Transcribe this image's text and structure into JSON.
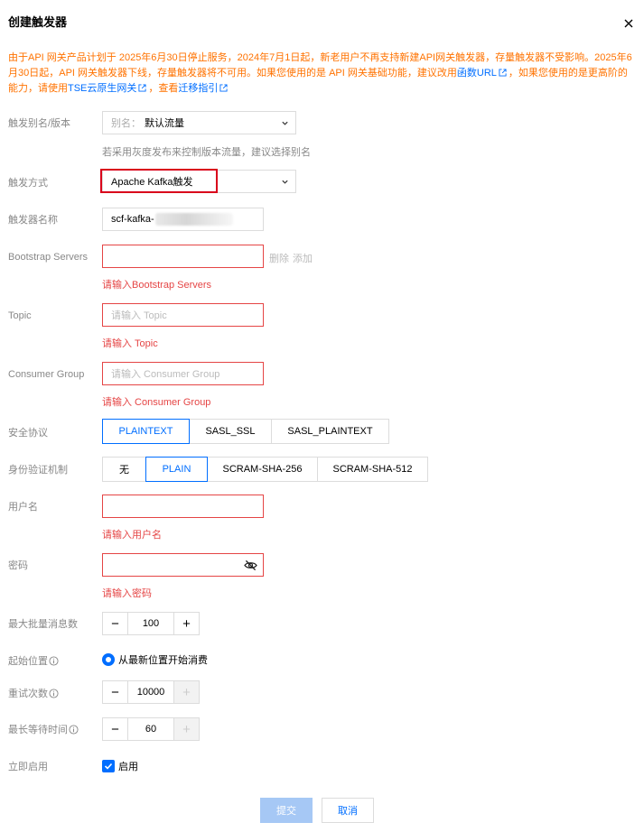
{
  "dialog": {
    "title": "创建触发器",
    "notice_part1": "由于API 网关产品计划于 2025年6月30日停止服务，2024年7月1日起，新老用户不再支持新建API网关触发器，存量触发器不受影响。2025年6月30日起，API 网关触发器下线，存量触发器将不可用。如果您使用的是 API 网关基础功能，建议改用",
    "notice_link1": "函数URL",
    "notice_part2": "，如果您使用的是更高阶的能力，请使用",
    "notice_link2": "TSE云原生网关",
    "notice_part3": "，查看",
    "notice_link3": "迁移指引"
  },
  "form": {
    "alias": {
      "label": "触发别名/版本",
      "prefix": "别名：",
      "value": "默认流量",
      "hint": "若采用灰度发布来控制版本流量，建议选择别名"
    },
    "trigger_type": {
      "label": "触发方式",
      "value": "Apache Kafka触发"
    },
    "trigger_name": {
      "label": "触发器名称",
      "value": "scf-kafka-"
    },
    "bootstrap": {
      "label": "Bootstrap Servers",
      "delete_label": "删除",
      "add_label": "添加",
      "error": "请输入Bootstrap Servers"
    },
    "topic": {
      "label": "Topic",
      "placeholder": "请输入 Topic",
      "error": "请输入 Topic"
    },
    "consumer_group": {
      "label": "Consumer Group",
      "placeholder": "请输入 Consumer Group",
      "error": "请输入 Consumer Group"
    },
    "security_protocol": {
      "label": "安全协议",
      "options": [
        "PLAINTEXT",
        "SASL_SSL",
        "SASL_PLAINTEXT"
      ],
      "selected": "PLAINTEXT"
    },
    "auth_mechanism": {
      "label": "身份验证机制",
      "options": [
        "无",
        "PLAIN",
        "SCRAM-SHA-256",
        "SCRAM-SHA-512"
      ],
      "selected": "PLAIN"
    },
    "username": {
      "label": "用户名",
      "error": "请输入用户名"
    },
    "password": {
      "label": "密码",
      "error": "请输入密码"
    },
    "max_batch": {
      "label": "最大批量消息数",
      "value": "100"
    },
    "start_position": {
      "label": "起始位置",
      "option": "从最新位置开始消费"
    },
    "retry_count": {
      "label": "重试次数",
      "value": "10000"
    },
    "max_wait": {
      "label": "最长等待时间",
      "value": "60"
    },
    "enable_now": {
      "label": "立即启用",
      "checkbox_label": "启用"
    }
  },
  "buttons": {
    "submit": "提交",
    "cancel": "取消"
  },
  "colors": {
    "accent": "#006eff",
    "error": "#e54545",
    "warning": "#ff7200"
  }
}
